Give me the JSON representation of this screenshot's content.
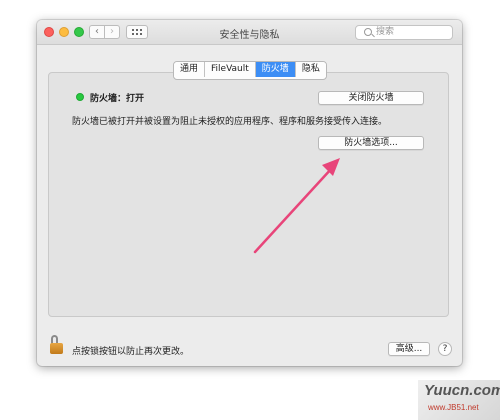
{
  "window": {
    "title": "安全性与隐私",
    "search_placeholder": "搜索"
  },
  "nav": {
    "back_icon": "chevron-left-icon",
    "forward_icon": "chevron-right-icon",
    "grid_icon": "show-all-grid-icon"
  },
  "tabs": [
    {
      "label": "通用",
      "active": false
    },
    {
      "label": "FileVault",
      "active": false
    },
    {
      "label": "防火墙",
      "active": true
    },
    {
      "label": "隐私",
      "active": false
    }
  ],
  "firewall": {
    "status": "防火墙：打开",
    "status_color": "#28c940",
    "description": "防火墙已被打开并被设置为阻止未授权的应用程序、程序和服务接受传入连接。",
    "turn_off_label": "关闭防火墙",
    "options_label": "防火墙选项..."
  },
  "footer": {
    "lock_text": "点按锁按钮以防止再次更改。",
    "advanced_label": "高级...",
    "help_label": "?"
  },
  "annotation": {
    "arrow_color": "#e8457a"
  },
  "watermark": {
    "main": "Yuucn.com",
    "sub": "www.JB51.net"
  }
}
